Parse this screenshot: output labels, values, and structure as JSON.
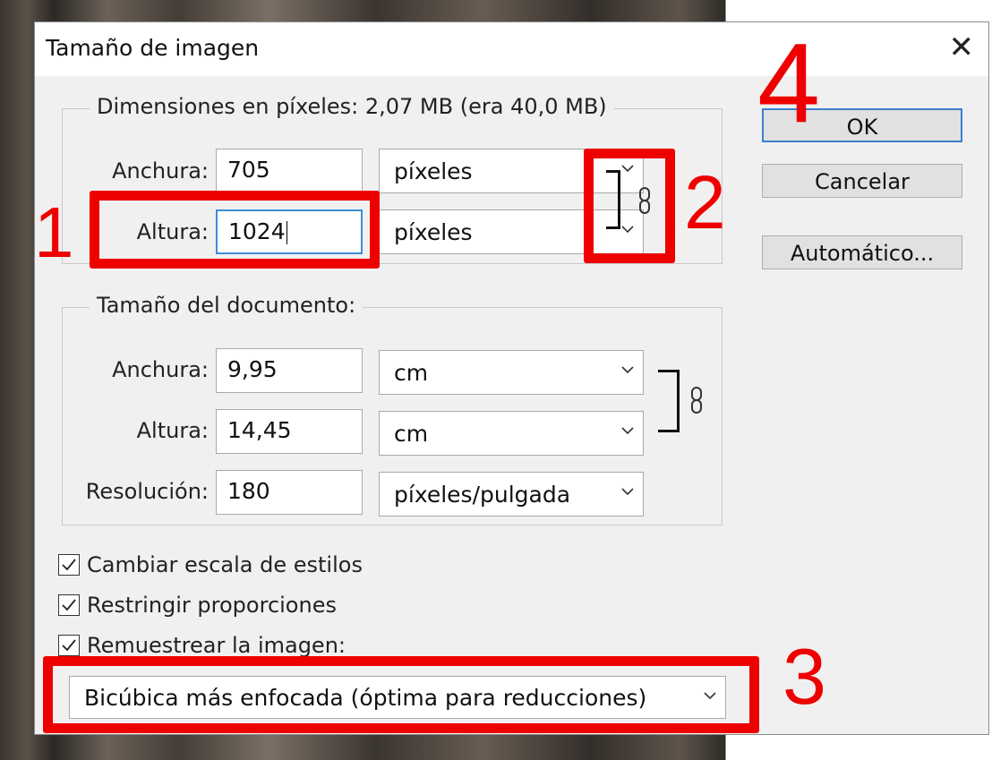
{
  "dialog": {
    "title": "Tamaño de imagen",
    "close_glyph": "✕"
  },
  "pixel_dimensions": {
    "legend": "Dimensiones en píxeles: 2,07 MB (era 40,0 MB)",
    "width_label": "Anchura:",
    "width_value": "705",
    "width_unit": "píxeles",
    "height_label": "Altura:",
    "height_value": "1024",
    "height_unit": "píxeles"
  },
  "document_size": {
    "legend": "Tamaño del documento:",
    "width_label": "Anchura:",
    "width_value": "9,95",
    "width_unit": "cm",
    "height_label": "Altura:",
    "height_value": "14,45",
    "height_unit": "cm",
    "resolution_label": "Resolución:",
    "resolution_value": "180",
    "resolution_unit": "píxeles/pulgada"
  },
  "options": {
    "scale_styles": {
      "label": "Cambiar escala de estilos",
      "checked": true
    },
    "constrain": {
      "label": "Restringir proporciones",
      "checked": true
    },
    "resample": {
      "label": "Remuestrear la imagen:",
      "checked": true
    },
    "resample_method": "Bicúbica más enfocada (óptima para reducciones)"
  },
  "buttons": {
    "ok": "OK",
    "cancel": "Cancelar",
    "auto": "Automático..."
  },
  "annotations": {
    "n1": "1",
    "n2": "2",
    "n3": "3",
    "n4": "4",
    "color": "#ee0000"
  },
  "icons": {
    "chain": "chain-link-icon",
    "chevron": "chevron-down-icon",
    "check": "checkmark-icon",
    "close": "close-icon"
  }
}
